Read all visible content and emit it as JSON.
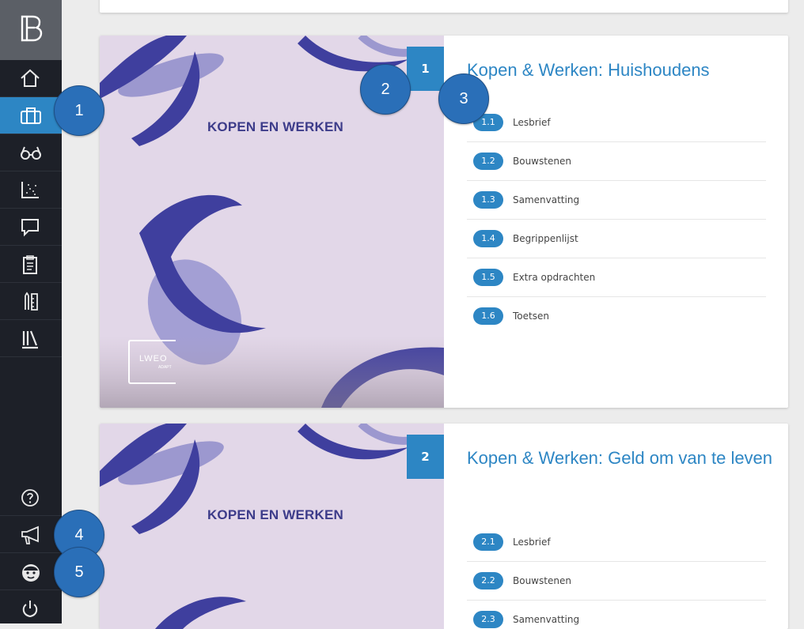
{
  "sidebar": {
    "items": [
      {
        "name": "home",
        "icon": "home-icon"
      },
      {
        "name": "briefcase",
        "icon": "briefcase-icon",
        "active": true
      },
      {
        "name": "glasses",
        "icon": "glasses-icon"
      },
      {
        "name": "chart",
        "icon": "scatter-chart-icon"
      },
      {
        "name": "chat",
        "icon": "chat-bubble-icon"
      },
      {
        "name": "clipboard",
        "icon": "clipboard-icon"
      },
      {
        "name": "tools",
        "icon": "pencil-tools-icon"
      },
      {
        "name": "library",
        "icon": "library-icon"
      }
    ],
    "bottom": [
      {
        "name": "help",
        "icon": "help-circle-icon"
      },
      {
        "name": "announcements",
        "icon": "megaphone-icon"
      },
      {
        "name": "profile",
        "icon": "avatar-icon"
      },
      {
        "name": "logout",
        "icon": "power-icon"
      }
    ],
    "active_color": "#2d86c4"
  },
  "chapters": [
    {
      "number": "1",
      "cover_title": "KOPEN EN WERKEN",
      "cover_logo": "LWEO",
      "cover_logo_sub": "ADAPT",
      "title": "Kopen & Werken: Huishoudens",
      "lessons": [
        {
          "num": "1.1",
          "label": "Lesbrief"
        },
        {
          "num": "1.2",
          "label": "Bouwstenen"
        },
        {
          "num": "1.3",
          "label": "Samenvatting"
        },
        {
          "num": "1.4",
          "label": "Begrippenlijst"
        },
        {
          "num": "1.5",
          "label": "Extra opdrachten"
        },
        {
          "num": "1.6",
          "label": "Toetsen"
        }
      ]
    },
    {
      "number": "2",
      "cover_title": "KOPEN EN WERKEN",
      "title": "Kopen & Werken: Geld om van te leven",
      "lessons": [
        {
          "num": "2.1",
          "label": "Lesbrief"
        },
        {
          "num": "2.2",
          "label": "Bouwstenen"
        },
        {
          "num": "2.3",
          "label": "Samenvatting"
        }
      ]
    }
  ],
  "callouts": [
    "1",
    "2",
    "3",
    "4",
    "5"
  ],
  "colors": {
    "accent": "#2d86c4",
    "callout": "#2a6fb8",
    "cover_bg": "#e2d7e8",
    "swirl": "#3f3f9e"
  }
}
